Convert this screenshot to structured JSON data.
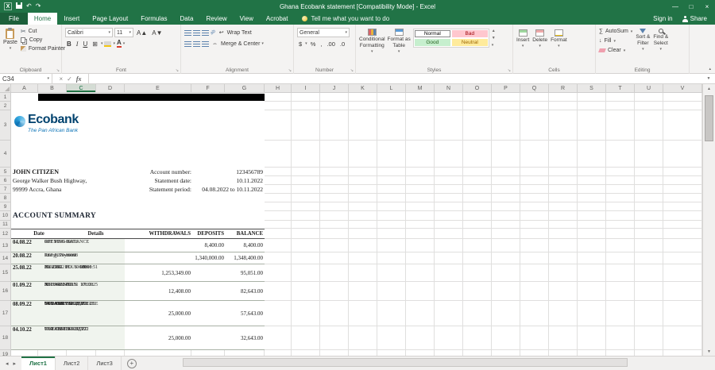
{
  "titlebar": {
    "title": "Ghana Ecobank statement  [Compatibility Mode] - Excel"
  },
  "tabs": [
    "File",
    "Home",
    "Insert",
    "Page Layout",
    "Formulas",
    "Data",
    "Review",
    "View",
    "Acrobat"
  ],
  "active_tab": "Home",
  "tellme": "Tell me what you want to do",
  "account": {
    "signin": "Sign in",
    "share": "Share"
  },
  "icons": {
    "excel": "X",
    "dropdown": "▾",
    "scissors": "✂",
    "undo": "↶",
    "redo": "↷",
    "minimize": "—",
    "maximize": "□",
    "close": "×",
    "check": "✓",
    "grow_font": "A▲",
    "shrink_font": "A▼",
    "borders": "⊞",
    "font_color": "A",
    "orientation": "ab",
    "wrap_arrow": "↩",
    "merge_arrow": "⇔",
    "sum": "∑",
    "fill_down": "↓",
    "up": "▲",
    "down": "▼",
    "launcher": "↘",
    "nav_left": "◂",
    "nav_right": "▸",
    "new_sheet": "+",
    "collapse": "▴"
  },
  "ribbon": {
    "clipboard": {
      "label": "Clipboard",
      "paste": "Paste",
      "cut": "Cut",
      "copy": "Copy",
      "format_painter": "Format Painter"
    },
    "font": {
      "label": "Font",
      "name": "Calibri",
      "size": "11",
      "bold": "B",
      "italic": "I",
      "underline": "U"
    },
    "alignment": {
      "label": "Alignment",
      "wrap": "Wrap Text",
      "merge": "Merge & Center"
    },
    "number": {
      "label": "Number",
      "format": "General",
      "currency": "$",
      "percent": "%",
      "comma": ",",
      "inc_decimal": ".00",
      "dec_decimal": ".0"
    },
    "styles": {
      "label": "Styles",
      "conditional1": "Conditional",
      "conditional2": "Formatting",
      "astable1": "Format as",
      "astable2": "Table",
      "cell_styles": [
        {
          "name": "Normal",
          "bg": "#ffffff",
          "fg": "#000000"
        },
        {
          "name": "Bad",
          "bg": "#ffc7ce",
          "fg": "#9c0006"
        },
        {
          "name": "Good",
          "bg": "#c6efce",
          "fg": "#276221"
        },
        {
          "name": "Neutral",
          "bg": "#ffeb9c",
          "fg": "#9c6500"
        }
      ]
    },
    "cells": {
      "label": "Cells",
      "insert": "Insert",
      "delete": "Delete",
      "format": "Format"
    },
    "editing": {
      "label": "Editing",
      "autosum": "AutoSum",
      "fill": "Fill",
      "clear": "Clear",
      "sort1": "Sort &",
      "sort2": "Filter",
      "find1": "Find &",
      "find2": "Select"
    }
  },
  "formula_bar": {
    "name_box": "C34",
    "fx": "fx"
  },
  "sheet": {
    "columns": [
      "A",
      "B",
      "C",
      "D",
      "E",
      "F",
      "G",
      "H",
      "I",
      "J",
      "K",
      "L",
      "M",
      "N",
      "O",
      "P",
      "Q",
      "R",
      "S",
      "T",
      "U",
      "V"
    ],
    "rows": [
      "1",
      "2",
      "3",
      "4",
      "5",
      "6",
      "7",
      "8",
      "9",
      "10",
      "11",
      "12",
      "13",
      "14",
      "15",
      "16",
      "17",
      "18",
      "19"
    ],
    "selected_column": "C"
  },
  "statement": {
    "logo": {
      "name": "Ecobank",
      "tagline": "The Pan African Bank"
    },
    "customer": {
      "name": "JOHN CITIZEN",
      "address1": "George Walker Bush Highway,",
      "address2": "99999 Accra, Ghana"
    },
    "fields": [
      {
        "label": "Account number:",
        "value": "123456789"
      },
      {
        "label": "Statement date:",
        "value": "10.11.2022"
      },
      {
        "label": "Statement period:",
        "value": "04.08.2022 to 10.11.2022"
      }
    ],
    "section_title": "ACCOUNT SUMMARY",
    "table": {
      "headers": [
        "Date",
        "Details",
        "WITHDRAWALS",
        "DEPOSITS",
        "BALANCE"
      ],
      "rows": [
        {
          "date": "04.08.22",
          "details": [
            "OPENING BALANCE",
            "REF P109-00078"
          ],
          "withdrawals": "",
          "deposits": "8,400.00",
          "balance": "8,400.00"
        },
        {
          "date": "20.08.22",
          "details": [
            "Energy Payment",
            "REF P220-00008"
          ],
          "withdrawals": "",
          "deposits": "1,340,000.00",
          "balance": "1,348,400.00"
        },
        {
          "date": "25.08.22",
          "details": [
            "25AUG22 PLUS   19:18:51",
            "N2 2519           100.00",
            "BK CHG  BD       60000"
          ],
          "withdrawals": "1,253,349.00",
          "deposits": "",
          "balance": "95,051.00"
        },
        {
          "date": "01.09.22",
          "details": [
            "30AUG22 PLUS   17:33:25",
            "N3 3940  SGD      100.00",
            "REF A900-00151"
          ],
          "withdrawals": "12,408.00",
          "deposits": "",
          "balance": "82,643.00"
        },
        {
          "date": "08.09.22",
          "details": [
            "MONTHLY SERVICE FEE",
            "04AUG21  TO  31AUG21",
            "TOT CHR BD 22,727",
            "TAXABLE BD 22,272",
            "TOT VAT  BD 2,272"
          ],
          "withdrawals": "25,000.00",
          "deposits": "",
          "balance": "57,643.00"
        },
        {
          "date": "04.10.22",
          "details": [
            "01SEP22 TO 30SEP22",
            "TOT CHR BD 22,727",
            "TAXABLE BD 22,272"
          ],
          "withdrawals": "25,000.00",
          "deposits": "",
          "balance": "32,643.00"
        }
      ]
    }
  },
  "sheet_tabs": {
    "tabs": [
      "Лист1",
      "Лист2",
      "Лист3"
    ],
    "active": "Лист1"
  },
  "colors": {
    "excel_green": "#217346",
    "black_bar": "#000000",
    "ecobank_blue": "#00426e",
    "ecobank_light_blue": "#0d74b7"
  }
}
